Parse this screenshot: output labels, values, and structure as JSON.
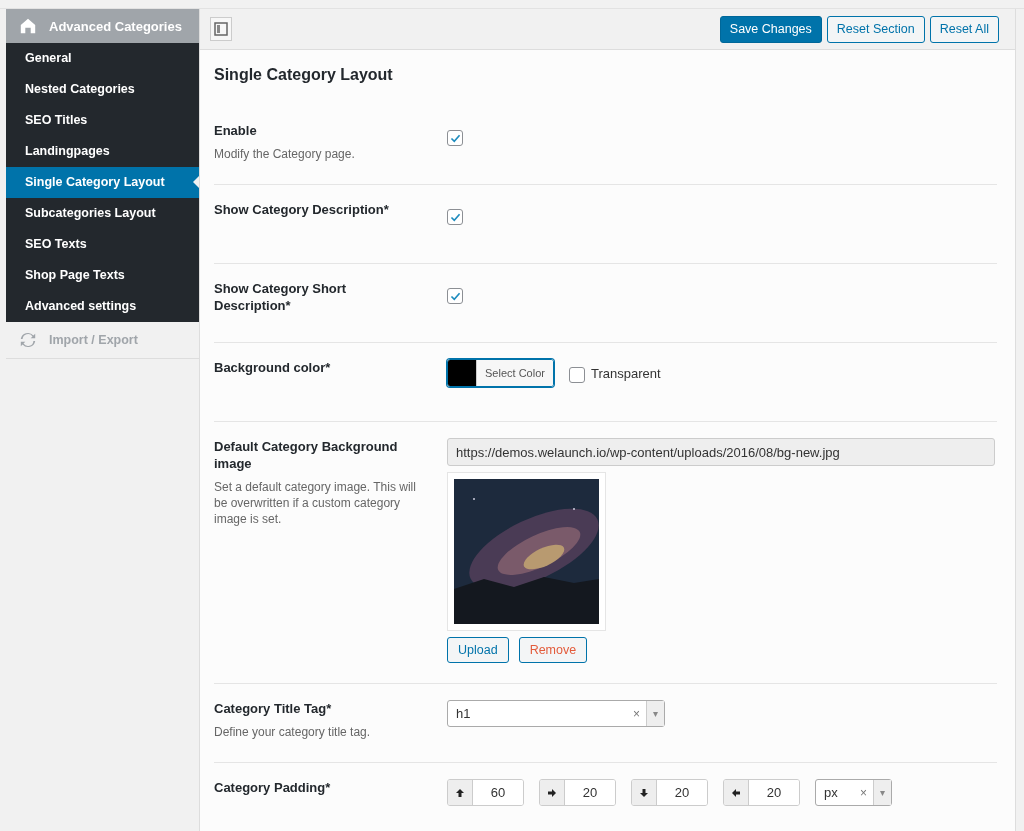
{
  "sidebar": {
    "title": "Advanced Categories",
    "items": [
      {
        "label": "General",
        "selected": false
      },
      {
        "label": "Nested Categories",
        "selected": false
      },
      {
        "label": "SEO Titles",
        "selected": false
      },
      {
        "label": "Landingpages",
        "selected": false
      },
      {
        "label": "Single Category Layout",
        "selected": true
      },
      {
        "label": "Subcategories Layout",
        "selected": false
      },
      {
        "label": "SEO Texts",
        "selected": false
      },
      {
        "label": "Shop Page Texts",
        "selected": false
      },
      {
        "label": "Advanced settings",
        "selected": false
      }
    ],
    "footer_item": "Import / Export"
  },
  "toolbar": {
    "buttons": [
      {
        "label": "Save Changes",
        "primary": true
      },
      {
        "label": "Reset Section",
        "primary": false
      },
      {
        "label": "Reset All",
        "primary": false
      }
    ]
  },
  "section_title": "Single Category Layout",
  "fields": [
    {
      "kind": "checkbox",
      "label": "Enable",
      "description": "Modify the Category page.",
      "checked": true
    },
    {
      "kind": "checkbox",
      "label": "Show Category Description*",
      "checked": true
    },
    {
      "kind": "checkbox",
      "label": "Show Category Short Description*",
      "checked": true
    },
    {
      "kind": "color",
      "label": "Background color*",
      "color": "#000000",
      "button": "Select Color",
      "transparent_label": "Transparent",
      "transparent_checked": false
    },
    {
      "label": "Default Category Background image",
      "description": "Set a default category image. This will be overwritten if a custom category image is set.",
      "value": "https://demos.welaunch.io/wp-content/uploads/2016/08/bg-new.jpg",
      "buttons": [
        "Upload",
        "Remove"
      ]
    },
    {
      "kind": "select",
      "label": "Category Title Tag*",
      "description": "Define your category title tag.",
      "value": "h1",
      "clear": "×",
      "caret": "▾"
    },
    {
      "kind": "spacing",
      "label": "Category Padding*",
      "values": [
        {
          "kind": "up",
          "value": "60"
        },
        {
          "kind": "right",
          "value": "20"
        },
        {
          "kind": "down",
          "value": "20"
        },
        {
          "kind": "left",
          "value": "20"
        }
      ],
      "unit": "px",
      "clear": "×",
      "caret": "▾"
    }
  ]
}
